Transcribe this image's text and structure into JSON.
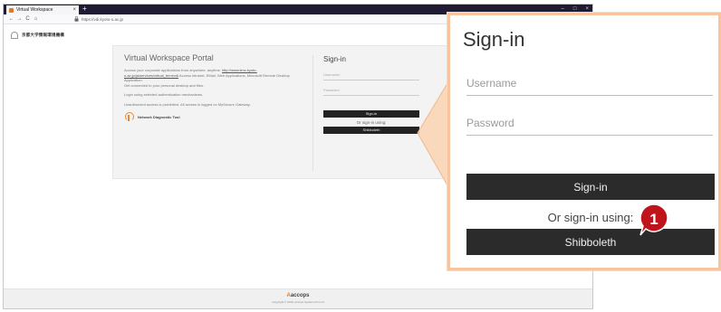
{
  "browser": {
    "tab_title": "Virtual Workspace",
    "tab_close": "×",
    "new_tab": "+",
    "window_controls": [
      "–",
      "□",
      "×"
    ],
    "nav": {
      "back": "←",
      "forward": "→",
      "reload": "C",
      "home": "⌂"
    },
    "address": "https://vdi.kyoto-u.ac.jp"
  },
  "site": {
    "logo_text": "京都大学情報環境機構"
  },
  "portal": {
    "title": "Virtual Workspace Portal",
    "description_1": "Access your corporate applications from anywhere, anytime.",
    "link_text": "http://www.iimc.kyoto-u.ac.jp/ja/services/virtual_term/vdi",
    "description_2": "Access Intranet, EMail, Web Applications, Microsoft Remote Desktop Application.",
    "description_3": "Get connected to your personal desktop and files.",
    "login_note": "Login using selected authentication mechanisms.",
    "warning": "Unauthorized access is prohibited. All access is logged on MySecure Gateway.",
    "diagnostic_label": "Network Diagnostic Tool",
    "signin_title": "Sign-in",
    "username_placeholder": "Username",
    "password_placeholder": "Password",
    "signin_button": "Sign-in",
    "or_text": "Or sign-in using:",
    "shibboleth_button": "Shibboleth"
  },
  "footer": {
    "brand_prefix": "A",
    "brand_name": "accops",
    "copyright": "Copyright © 2018, Accops Systems Pvt Ltd"
  },
  "zoom": {
    "title": "Sign-in",
    "username_placeholder": "Username",
    "password_placeholder": "Password",
    "signin_button": "Sign-in",
    "or_text": "Or sign-in using:",
    "shibboleth_button": "Shibboleth"
  },
  "badge": {
    "number": "1"
  },
  "colors": {
    "tabbar": "#1f1b33",
    "button_dark": "#2b2b2b",
    "callout_border": "#f6c49e",
    "badge_red": "#c0141c",
    "accent_orange": "#e07a2b"
  }
}
